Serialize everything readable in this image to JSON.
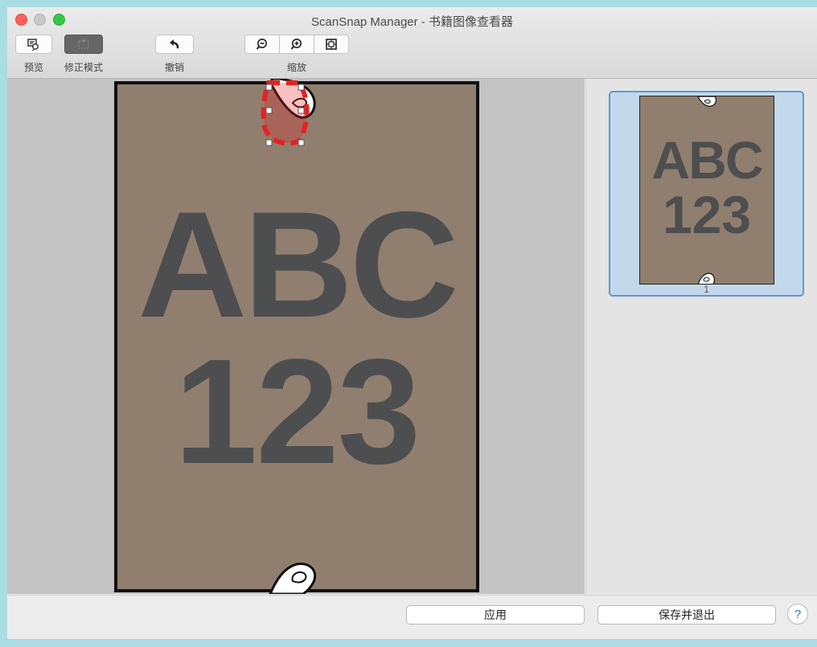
{
  "window": {
    "title": "ScanSnap Manager - 书籍图像查看器",
    "controls": {
      "close": "close-icon",
      "minimize": "minimize-icon",
      "zoom": "zoom-window-icon"
    }
  },
  "toolbar": {
    "preview_label": "预览",
    "correction_mode_label": "修正模式",
    "undo_label": "撤销",
    "zoom_label": "缩放",
    "icons": {
      "preview": "preview-icon",
      "correction": "correction-mode-icon",
      "undo": "undo-icon",
      "zoom_out": "zoom-out-icon",
      "zoom_in": "zoom-in-icon",
      "fit": "fit-page-icon"
    }
  },
  "document": {
    "line1": "ABC",
    "line2": "123",
    "colors": {
      "paper": "#907f6e",
      "text": "#4d4e4f",
      "selection": "#e52222"
    }
  },
  "thumbnails": [
    {
      "line1": "ABC",
      "line2": "123",
      "page_number": "1",
      "selected": true
    }
  ],
  "footer": {
    "apply_label": "应用",
    "save_exit_label": "保存并退出",
    "help_label": "?"
  }
}
